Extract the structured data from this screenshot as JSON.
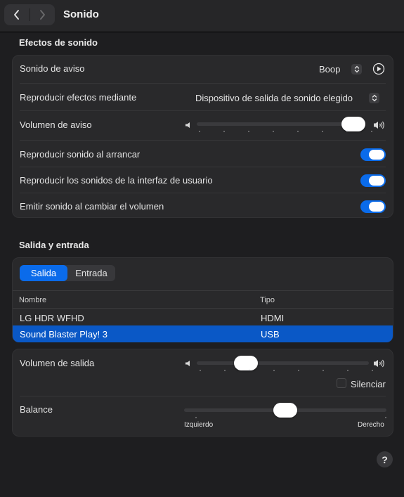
{
  "window": {
    "title": "Sonido",
    "back_icon": "chevron-left-icon",
    "forward_icon": "chevron-right-icon"
  },
  "sound_effects": {
    "section_title": "Efectos de sonido",
    "alert_sound": {
      "label": "Sonido de aviso",
      "value": "Boop"
    },
    "play_via": {
      "label": "Reproducir efectos mediante",
      "value": "Dispositivo de salida de sonido elegido"
    },
    "alert_volume": {
      "label": "Volumen de aviso",
      "level": 1.0
    },
    "startup_sound": {
      "label": "Reproducir sonido al arrancar",
      "on": true
    },
    "ui_sounds": {
      "label": "Reproducir los sonidos de la interfaz de usuario",
      "on": true
    },
    "volume_feedback": {
      "label": "Emitir sonido al cambiar el volumen",
      "on": true
    }
  },
  "output_input": {
    "section_title": "Salida y entrada",
    "tabs": [
      {
        "label": "Salida",
        "selected": true
      },
      {
        "label": "Entrada",
        "selected": false
      }
    ],
    "columns": {
      "name": "Nombre",
      "type": "Tipo"
    },
    "devices": [
      {
        "name": "LG HDR WFHD",
        "type": "HDMI",
        "selected": false
      },
      {
        "name": "Sound Blaster Play! 3",
        "type": "USB",
        "selected": true
      }
    ]
  },
  "output_volume": {
    "label": "Volumen de salida",
    "level": 0.25,
    "mute_label": "Silenciar",
    "muted": false
  },
  "balance": {
    "label": "Balance",
    "level": 0.5,
    "left_label": "Izquierdo",
    "right_label": "Derecho"
  },
  "help": {
    "label": "?"
  },
  "colors": {
    "accent": "#0a6bea",
    "selection": "#0a58c6",
    "background": "#1e1e20",
    "card": "#29292b"
  }
}
